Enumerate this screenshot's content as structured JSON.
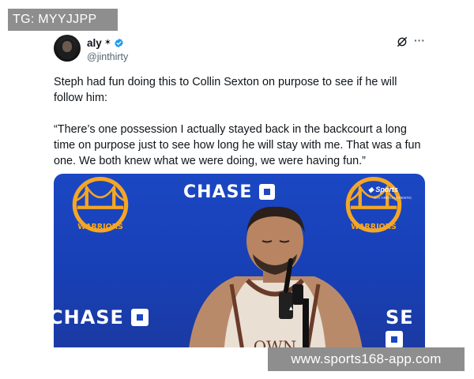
{
  "watermarks": {
    "top": "TG: MYYJJPP",
    "bottom": "www.sports168-app.com"
  },
  "tweet": {
    "display_name": "aly",
    "handle": "@jinthirty",
    "text_para1": "Steph had fun doing this to Collin Sexton on purpose to see if he will follow him:",
    "text_para2": "“There’s one possession I actually stayed back in the backcourt a long time on purpose just to see how long he will stay with me. That was a fun one. We both knew what we were doing, we were having fun.”",
    "icons": {
      "sparkle": "sparkle-icon",
      "verified": "verified-badge-icon",
      "grok": "grok-icon",
      "more": "more-options-icon"
    }
  },
  "media": {
    "backdrop_text_top": "CHASE",
    "backdrop_text_left": "CHASE",
    "backdrop_text_right": "SE",
    "logo_text": "WARRIORS",
    "broadcaster": "Sports",
    "broadcaster_sub": "BAY AREA AUTHENTIC",
    "jersey_text": "OWN",
    "colors": {
      "backdrop": "#1b47c3",
      "warriors_gold": "#f5a623",
      "verified_blue": "#1d9bf0"
    }
  }
}
